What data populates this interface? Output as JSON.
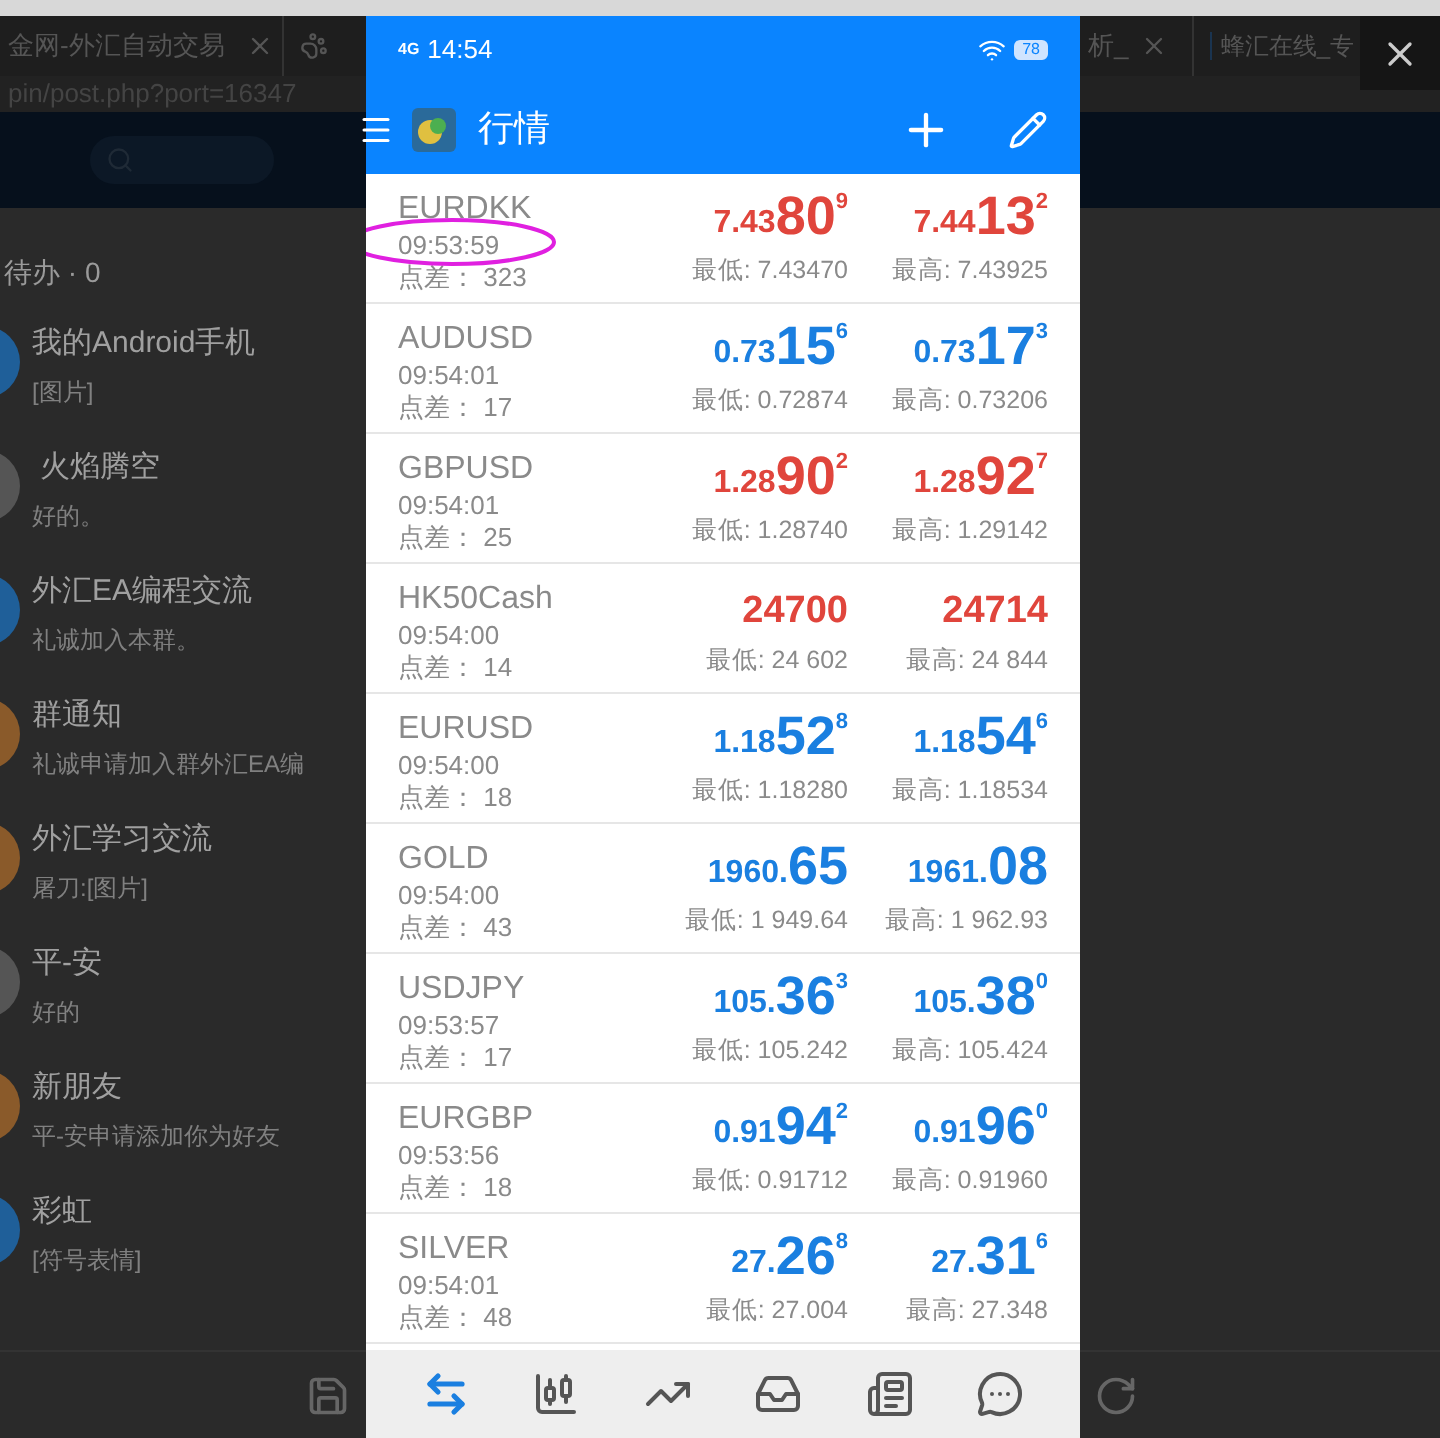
{
  "browser": {
    "tabs": [
      {
        "label": "金网-外汇自动交易"
      },
      {
        "label": "析_"
      },
      {
        "label": "蜂汇在线_专"
      }
    ],
    "url": "pin/post.php?port=16347"
  },
  "chat_list": {
    "todo": "待办 · 0",
    "chats": [
      {
        "name": "我的Android手机",
        "preview": "[图片]",
        "color": "#1f5f99"
      },
      {
        "name": " 火焰腾空",
        "preview": "好的。",
        "color": "#555555"
      },
      {
        "name": "外汇EA编程交流",
        "preview": "礼诚加入本群。",
        "color": "#1f5f99"
      },
      {
        "name": "群通知",
        "preview": "礼诚申请加入群外汇EA编",
        "color": "#8a5a2a"
      },
      {
        "name": "外汇学习交流",
        "preview": "屠刀:[图片]",
        "color": "#8a5a2a"
      },
      {
        "name": "平-安",
        "preview": "好的",
        "color": "#555555"
      },
      {
        "name": "新朋友",
        "preview": "平-安申请添加你为好友",
        "color": "#8a5a2a"
      },
      {
        "name": "彩虹",
        "preview": "[符号表情]",
        "color": "#1f5f99"
      }
    ]
  },
  "phone": {
    "status_bar": {
      "network": "4G",
      "time": "14:54",
      "battery": "78"
    },
    "app_bar": {
      "title": "行情"
    },
    "quotes": [
      {
        "symbol": "EURDKK",
        "time": "09:53:59",
        "spread": "点差： 323",
        "color": "#e0453c",
        "bid": {
          "main": "7.43",
          "big": "80",
          "sup": "9"
        },
        "ask": {
          "main": "7.44",
          "big": "13",
          "sup": "2"
        },
        "low": "最低: 7.43470",
        "high": "最高: 7.43925",
        "circled": true
      },
      {
        "symbol": "AUDUSD",
        "time": "09:54:01",
        "spread": "点差： 17",
        "color": "#1a7fe0",
        "bid": {
          "main": "0.73",
          "big": "15",
          "sup": "6"
        },
        "ask": {
          "main": "0.73",
          "big": "17",
          "sup": "3"
        },
        "low": "最低: 0.72874",
        "high": "最高: 0.73206",
        "circled": false
      },
      {
        "symbol": "GBPUSD",
        "time": "09:54:01",
        "spread": "点差： 25",
        "color": "#e0453c",
        "bid": {
          "main": "1.28",
          "big": "90",
          "sup": "2"
        },
        "ask": {
          "main": "1.28",
          "big": "92",
          "sup": "7"
        },
        "low": "最低: 1.28740",
        "high": "最高: 1.29142",
        "circled": false
      },
      {
        "symbol": "HK50Cash",
        "time": "09:54:00",
        "spread": "点差： 14",
        "color": "#e0453c",
        "bid": {
          "main": "24700"
        },
        "ask": {
          "main": "24714"
        },
        "low": "最低: 24 602",
        "high": "最高: 24 844",
        "circled": false
      },
      {
        "symbol": "EURUSD",
        "time": "09:54:00",
        "spread": "点差： 18",
        "color": "#1a7fe0",
        "bid": {
          "main": "1.18",
          "big": "52",
          "sup": "8"
        },
        "ask": {
          "main": "1.18",
          "big": "54",
          "sup": "6"
        },
        "low": "最低: 1.18280",
        "high": "最高: 1.18534",
        "circled": false
      },
      {
        "symbol": "GOLD",
        "time": "09:54:00",
        "spread": "点差： 43",
        "color": "#1a7fe0",
        "bid": {
          "main": "1960.",
          "big": "65"
        },
        "ask": {
          "main": "1961.",
          "big": "08"
        },
        "low": "最低: 1 949.64",
        "high": "最高: 1 962.93",
        "circled": false
      },
      {
        "symbol": "USDJPY",
        "time": "09:53:57",
        "spread": "点差： 17",
        "color": "#1a7fe0",
        "bid": {
          "main": "105.",
          "big": "36",
          "sup": "3"
        },
        "ask": {
          "main": "105.",
          "big": "38",
          "sup": "0"
        },
        "low": "最低: 105.242",
        "high": "最高: 105.424",
        "circled": false
      },
      {
        "symbol": "EURGBP",
        "time": "09:53:56",
        "spread": "点差： 18",
        "color": "#1a7fe0",
        "bid": {
          "main": "0.91",
          "big": "94",
          "sup": "2"
        },
        "ask": {
          "main": "0.91",
          "big": "96",
          "sup": "0"
        },
        "low": "最低: 0.91712",
        "high": "最高: 0.91960",
        "circled": false
      },
      {
        "symbol": "SILVER",
        "time": "09:54:01",
        "spread": "点差： 48",
        "color": "#1a7fe0",
        "bid": {
          "main": "27.",
          "big": "26",
          "sup": "8"
        },
        "ask": {
          "main": "27.",
          "big": "31",
          "sup": "6"
        },
        "low": "最低: 27.004",
        "high": "最高: 27.348",
        "circled": false
      }
    ],
    "nav": [
      {
        "kind": "quotes",
        "selected": true
      },
      {
        "kind": "chart",
        "selected": false
      },
      {
        "kind": "trade",
        "selected": false
      },
      {
        "kind": "history",
        "selected": false
      },
      {
        "kind": "news",
        "selected": false
      },
      {
        "kind": "chat",
        "selected": false
      }
    ]
  }
}
